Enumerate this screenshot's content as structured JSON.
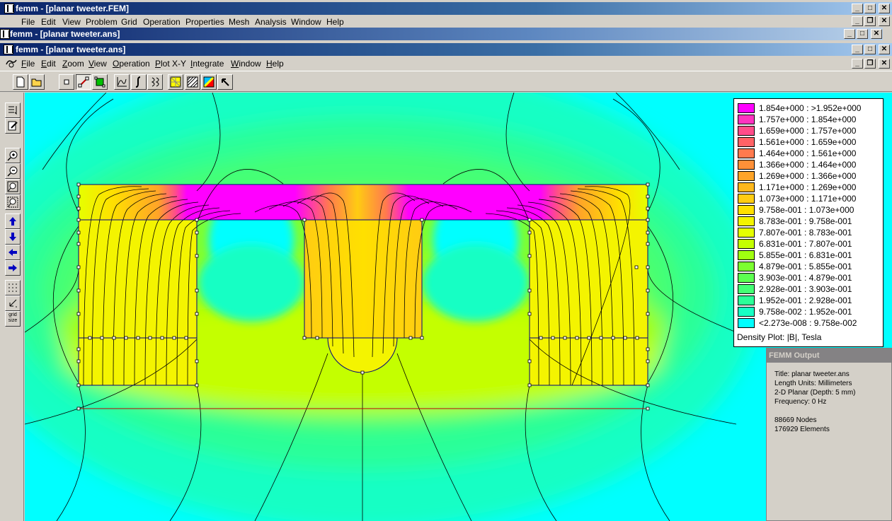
{
  "windows": {
    "back": {
      "title": "femm - [planar tweeter.FEM]",
      "menu": [
        "File",
        "Edit",
        "View",
        "Problem",
        "Grid",
        "Operation",
        "Properties",
        "Mesh",
        "Analysis",
        "Window",
        "Help"
      ]
    },
    "middle": {
      "title": "femm - [planar tweeter.ans]"
    },
    "front": {
      "title": "femm - [planar tweeter.ans]"
    }
  },
  "menu": [
    {
      "label": "File",
      "key": "F"
    },
    {
      "label": "Edit",
      "key": "E"
    },
    {
      "label": "Zoom",
      "key": "Z"
    },
    {
      "label": "View",
      "key": "V"
    },
    {
      "label": "Operation",
      "key": "O"
    },
    {
      "label": "Plot X-Y",
      "key": "P"
    },
    {
      "label": "Integrate",
      "key": "I"
    },
    {
      "label": "Window",
      "key": "W"
    },
    {
      "label": "Help",
      "key": "H"
    }
  ],
  "toolbar": [
    "new-file",
    "open-file",
    "select-nodes",
    "select-segments",
    "select-blocks",
    "plot-xy",
    "integrate",
    "contour",
    "show-mesh",
    "show-density",
    "show-vectors",
    "arrow-pointer"
  ],
  "left_toolbar": [
    "zoom-in",
    "zoom-out",
    "zoom-natural",
    "zoom-window",
    "pan-up",
    "pan-down",
    "pan-left",
    "pan-right",
    "show-grid",
    "snap-grid",
    "grid-size"
  ],
  "left_toolbar_text": {
    "grid_size": "grid size"
  },
  "legend": {
    "items": [
      {
        "color": "#ff00ff",
        "label": "1.854e+000 : >1.952e+000"
      },
      {
        "color": "#ff33c0",
        "label": "1.757e+000 : 1.854e+000"
      },
      {
        "color": "#ff4d8a",
        "label": "1.659e+000 : 1.757e+000"
      },
      {
        "color": "#ff6366",
        "label": "1.561e+000 : 1.659e+000"
      },
      {
        "color": "#ff7a4e",
        "label": "1.464e+000 : 1.561e+000"
      },
      {
        "color": "#ff9038",
        "label": "1.366e+000 : 1.464e+000"
      },
      {
        "color": "#ffa428",
        "label": "1.269e+000 : 1.366e+000"
      },
      {
        "color": "#ffb81c",
        "label": "1.171e+000 : 1.269e+000"
      },
      {
        "color": "#ffcc12",
        "label": "1.073e+000 : 1.171e+000"
      },
      {
        "color": "#ffe000",
        "label": "9.758e-001 : 1.073e+000"
      },
      {
        "color": "#f4f400",
        "label": "8.783e-001 : 9.758e-001"
      },
      {
        "color": "#e6ff00",
        "label": "7.807e-001 : 8.783e-001"
      },
      {
        "color": "#c4ff00",
        "label": "6.831e-001 : 7.807e-001"
      },
      {
        "color": "#a0ff10",
        "label": "5.855e-001 : 6.831e-001"
      },
      {
        "color": "#7cff30",
        "label": "4.879e-001 : 5.855e-001"
      },
      {
        "color": "#5cff50",
        "label": "3.903e-001 : 4.879e-001"
      },
      {
        "color": "#44ff74",
        "label": "2.928e-001 : 3.903e-001"
      },
      {
        "color": "#2cff98",
        "label": "1.952e-001 : 2.928e-001"
      },
      {
        "color": "#18ffc4",
        "label": "9.758e-002 : 1.952e-001"
      },
      {
        "color": "#00ffff",
        "label": "<2.273e-008 : 9.758e-002"
      }
    ],
    "caption": "Density Plot: |B|, Tesla"
  },
  "output": {
    "title": "FEMM Output",
    "lines": [
      "Title: planar tweeter.ans",
      "Length Units: Millimeters",
      "2-D Planar (Depth: 5 mm)",
      "Frequency: 0 Hz",
      "",
      "88669 Nodes",
      "176929 Elements"
    ]
  }
}
